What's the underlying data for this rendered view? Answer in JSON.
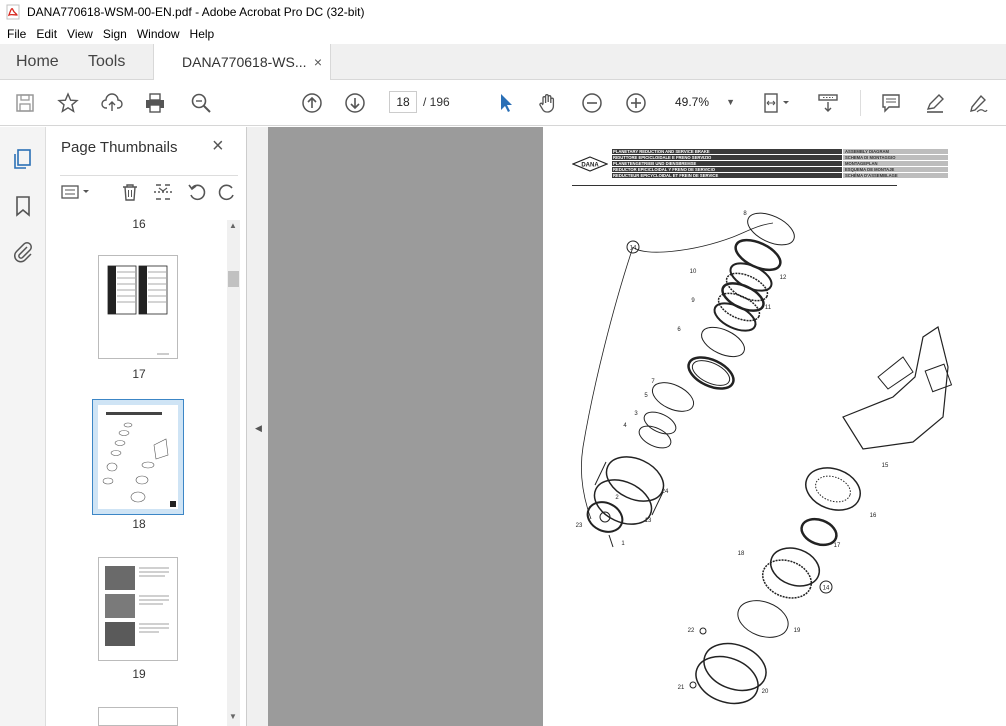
{
  "window": {
    "title": "DANA770618-WSM-00-EN.pdf - Adobe Acrobat Pro DC (32-bit)"
  },
  "menu": {
    "items": [
      "File",
      "Edit",
      "View",
      "Sign",
      "Window",
      "Help"
    ]
  },
  "tabs": {
    "home": "Home",
    "tools": "Tools",
    "document": "DANA770618-WS...",
    "close": "×"
  },
  "toolbar": {
    "page_current": "18",
    "page_total": "/ 196",
    "zoom": "49.7%"
  },
  "thumbnails": {
    "title": "Page Thumbnails",
    "close": "×",
    "pages": [
      "16",
      "17",
      "18",
      "19"
    ],
    "selected": "18"
  },
  "document": {
    "logo": "DANA",
    "header_rows": [
      {
        "left": "PLANETARY REDUCTION AND SERVICE BRAKE",
        "right": "ASSEMBLY DIAGRAM"
      },
      {
        "left": "RIDUTTORE EPICICLOIDALE E FRENO SERVIZIO",
        "right": "SCHEMA DI MONTAGGIO"
      },
      {
        "left": "PLANETENGETRIEB UND DIENSBREMSE",
        "right": "MONTAGEPLAN"
      },
      {
        "left": "REDUCTOR EPICICLOIDAL Y FRENO DE SERVICIO",
        "right": "ESQUEMA DE MONTAJE"
      },
      {
        "left": "REDUCTEUR EPICYCLOIDAL ET FREIN DE SERVICE",
        "right": "SCHÉMA D'ASSEMBLAGE"
      }
    ],
    "part_labels": [
      "8",
      "14",
      "10",
      "12",
      "9",
      "11",
      "6",
      "7",
      "5",
      "3",
      "4",
      "24",
      "2",
      "13",
      "1",
      "23",
      "15",
      "16",
      "17",
      "18",
      "14",
      "19",
      "22",
      "20",
      "21"
    ]
  },
  "colors": {
    "accent": "#2a6fb6",
    "canvas": "#9b9b9b",
    "selection": "#cfe4f5",
    "title_icon": "#d7281f"
  }
}
